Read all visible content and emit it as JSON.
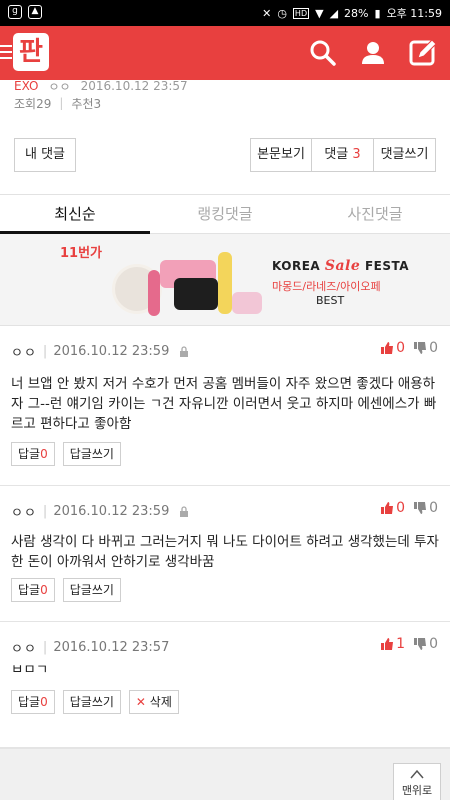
{
  "status_bar": {
    "battery": "28%",
    "time": "오후 11:59"
  },
  "app": {
    "logo": "판",
    "icons": [
      "search-icon",
      "user-icon",
      "write-icon"
    ],
    "accent": "#e8403f"
  },
  "post": {
    "author": "EXO",
    "nick": "ㅇㅇ",
    "date": "2016.10.12 23:57",
    "views": "조회29",
    "recommends": "추천3"
  },
  "buttons": {
    "my_comments": "내 댓글",
    "view_post": "본문보기",
    "comments_label": "댓글",
    "comments_count": "3",
    "write_comment": "댓글쓰기"
  },
  "tabs": [
    {
      "label": "최신순",
      "active": true
    },
    {
      "label": "랭킹댓글",
      "active": false
    },
    {
      "label": "사진댓글",
      "active": false
    }
  ],
  "ad": {
    "badge": "11번가",
    "korea": "KOREA",
    "sale": "Sale",
    "festa": "FESTA",
    "brands": "마몽드/라네즈/아이오페",
    "best": "BEST"
  },
  "comments": [
    {
      "nick": "ㅇㅇ",
      "date": "2016.10.12 23:59",
      "up": "0",
      "down": "0",
      "text": "너 브앱 안 봤지 저거 수호가 먼저 공홈 멤버들이 자주 왔으면 좋겠다 애용하자 그--런 얘기임 카이는 ㄱ건 자유니깐 이러면서 웃고 하지마 에센에스가 빠르고 편하다고 좋아함",
      "reply_label": "답글",
      "reply_count": "0",
      "write_reply": "답글쓰기"
    },
    {
      "nick": "ㅇㅇ",
      "date": "2016.10.12 23:59",
      "up": "0",
      "down": "0",
      "text": "사람 생각이 다 바뀌고 그러는거지 뭐 나도 다이어트 하려고 생각했는데 투자한 돈이 아까워서 안하기로 생각바꿈",
      "reply_label": "답글",
      "reply_count": "0",
      "write_reply": "답글쓰기"
    },
    {
      "nick": "ㅇㅇ",
      "date": "2016.10.12 23:57",
      "up": "1",
      "down": "0",
      "text": "ㅂㅁㄱ",
      "reply_label": "답글",
      "reply_count": "0",
      "write_reply": "답글쓰기",
      "delete_label": "삭제"
    }
  ],
  "footer": {
    "to_top": "맨위로"
  }
}
